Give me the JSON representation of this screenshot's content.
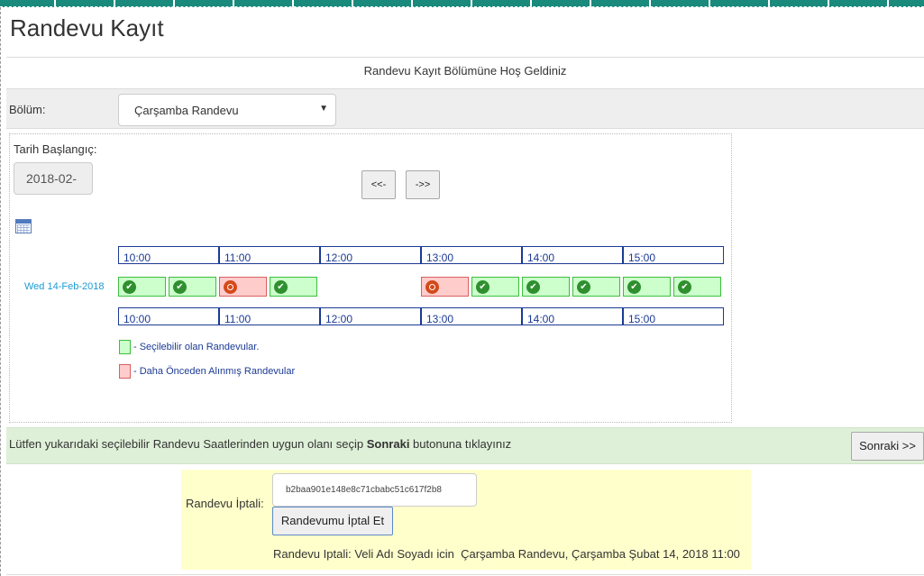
{
  "page_title": "Randevu Kayıt",
  "welcome": "Randevu Kayıt Bölümüne Hoş Geldiniz",
  "bolum": {
    "label": "Bölüm:",
    "selected": "Çarşamba Randevu"
  },
  "date_start": {
    "label": "Tarih Başlangıç:",
    "value": "2018-02-"
  },
  "nav": {
    "prev": "<<-",
    "next": "->>"
  },
  "calendar_icon": "calendar-icon",
  "hours": [
    "10:00",
    "11:00",
    "12:00",
    "13:00",
    "14:00",
    "15:00"
  ],
  "day_label": "Wed 14-Feb-2018",
  "slots": [
    {
      "status": "available"
    },
    {
      "status": "available"
    },
    {
      "status": "taken"
    },
    {
      "status": "available"
    },
    {
      "status": "empty"
    },
    {
      "status": "empty"
    },
    {
      "status": "taken"
    },
    {
      "status": "available"
    },
    {
      "status": "available"
    },
    {
      "status": "available"
    },
    {
      "status": "available"
    },
    {
      "status": "available"
    }
  ],
  "legend": {
    "available": "- Seçilebilir olan Randevular.",
    "taken": "- Daha Önceden Alınmış Randevular"
  },
  "info": {
    "prefix": "Lütfen yukarıdaki seçilebilir Randevu Saatlerinden uygun olanı seçip ",
    "bold": "Sonraki",
    "suffix": " butonuna tıklayınız"
  },
  "next_button": "Sonraki >>",
  "cancel": {
    "label": "Randevu İptali:",
    "code": "b2baa901e148e8c71cbabc51c617f2b8",
    "button": "Randevumu İptal Et",
    "info": "Randevu Iptali: Veli Adı Soyadı icin  Çarşamba Randevu, Çarşamba Şubat 14, 2018 11:00"
  },
  "colors": {
    "available_bg": "#ccffcc",
    "taken_bg": "#ffcccc",
    "hour_border": "#1b3a94",
    "info_bg": "#dff0d8",
    "cancel_bg": "#ffffcc",
    "teal": "#1a8a7c"
  }
}
